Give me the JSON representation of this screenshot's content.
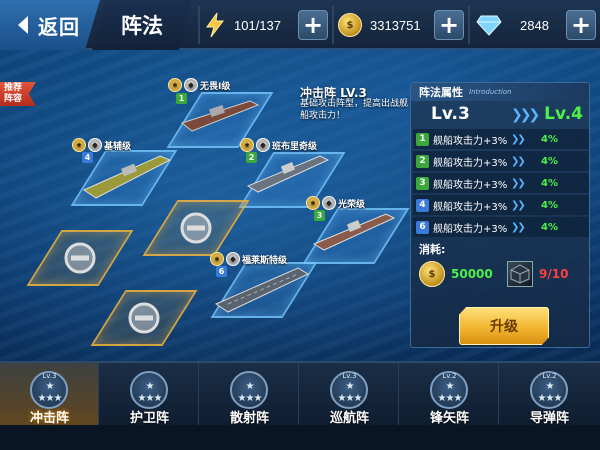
{
  "header": {
    "back_label": "返回",
    "title": "阵法",
    "energy": "101/137",
    "gold": "3313751",
    "diamond": "2848"
  },
  "recommend_tag": "推荐\n阵容",
  "ships": [
    {
      "name": "无畏I级",
      "slot": "1"
    },
    {
      "name": "基辅级",
      "slot": "4"
    },
    {
      "name": "班布里奇级",
      "slot": "2"
    },
    {
      "name": "光荣级",
      "slot": "3"
    },
    {
      "name": "福莱斯特级",
      "slot": "6"
    }
  ],
  "formation": {
    "name": "冲击阵 LV.3",
    "description": "基础攻击阵型，提高出战舰船攻击力！"
  },
  "attr_panel": {
    "title": "阵法属性",
    "subtitle": "Introduction",
    "current_level": "Lv.3",
    "next_level": "Lv.4",
    "rows": [
      {
        "index": "1",
        "name": "舰船攻击力+3%",
        "next": "4%",
        "color": "#3aa83a"
      },
      {
        "index": "2",
        "name": "舰船攻击力+3%",
        "next": "4%",
        "color": "#3aa83a"
      },
      {
        "index": "3",
        "name": "舰船攻击力+3%",
        "next": "4%",
        "color": "#3aa83a"
      },
      {
        "index": "4",
        "name": "舰船攻击力+3%",
        "next": "4%",
        "color": "#3a7ad8"
      },
      {
        "index": "6",
        "name": "舰船攻击力+3%",
        "next": "4%",
        "color": "#3a7ad8"
      }
    ],
    "cost_label": "消耗:",
    "coin_cost": "50000",
    "item_cost": "9/10",
    "upgrade_label": "升级"
  },
  "tabs": [
    {
      "label": "冲击阵",
      "level": "Lv.3",
      "active": true
    },
    {
      "label": "护卫阵",
      "level": "",
      "active": false
    },
    {
      "label": "散射阵",
      "level": "",
      "active": false
    },
    {
      "label": "巡航阵",
      "level": "Lv.3",
      "active": false
    },
    {
      "label": "锋矢阵",
      "level": "Lv.2",
      "active": false
    },
    {
      "label": "导弹阵",
      "level": "Lv.2",
      "active": false
    }
  ],
  "colors": {
    "accent_green": "#4ef04a",
    "cost_red": "#ff4040",
    "gold": "#f2b530",
    "tile_blue": "#78c8ff",
    "tile_locked": "#f0b43c"
  },
  "icons": {
    "energy": "lightning-icon",
    "gold": "coin-icon",
    "diamond": "diamond-icon",
    "lock": "lock-icon",
    "star": "star-icon"
  }
}
